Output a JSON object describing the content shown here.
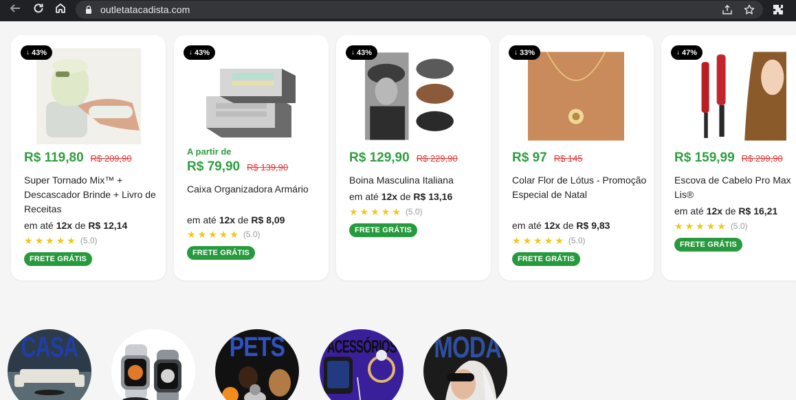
{
  "browser": {
    "url": "outletatacadista.com",
    "icons": [
      "back-arrow-icon",
      "reload-icon",
      "home-icon",
      "lock-icon",
      "share-icon",
      "star-icon",
      "extensions-icon"
    ]
  },
  "colors": {
    "price_green": "#2e9e3f",
    "old_price_red": "#e2332f",
    "badge_bg": "#000000",
    "frete_bg": "#279a3d",
    "star": "#f5c518"
  },
  "products": [
    {
      "discount": "43%",
      "from_label": "",
      "price": "R$ 119,80",
      "old_price": "R$ 209,90",
      "title": "Super Tornado Mix™ + Descascador Brinde + Livro de Receitas",
      "inst_prefix": "em até",
      "inst_times": "12x",
      "inst_de": "de",
      "inst_value": "R$ 12,14",
      "rating": "(5.0)",
      "rating_value": 5,
      "frete": "FRETE GRÁTIS"
    },
    {
      "discount": "43%",
      "from_label": "A partir de",
      "price": "R$ 79,90",
      "old_price": "R$ 139,90",
      "title": "Caixa Organizadora Armário",
      "inst_prefix": "em até",
      "inst_times": "12x",
      "inst_de": "de",
      "inst_value": "R$ 8,09",
      "rating": "(5.0)",
      "rating_value": 5,
      "frete": "FRETE GRÁTIS"
    },
    {
      "discount": "43%",
      "from_label": "",
      "price": "R$ 129,90",
      "old_price": "R$ 229,90",
      "title": "Boina Masculina Italiana",
      "inst_prefix": "em até",
      "inst_times": "12x",
      "inst_de": "de",
      "inst_value": "R$ 13,16",
      "rating": "(5.0)",
      "rating_value": 5,
      "frete": "FRETE GRÁTIS"
    },
    {
      "discount": "33%",
      "from_label": "",
      "price": "R$ 97",
      "old_price": "R$ 145",
      "title": "Colar Flor de Lótus - Promoção Especial de Natal",
      "inst_prefix": "em até",
      "inst_times": "12x",
      "inst_de": "de",
      "inst_value": "R$ 9,83",
      "rating": "(5.0)",
      "rating_value": 5,
      "frete": "FRETE GRÁTIS"
    },
    {
      "discount": "47%",
      "from_label": "",
      "price": "R$ 159,99",
      "old_price": "R$ 299,90",
      "title": "Escova de Cabelo Pro Max Lis®",
      "inst_prefix": "em até",
      "inst_times": "12x",
      "inst_de": "de",
      "inst_value": "R$ 16,21",
      "rating": "(5.0)",
      "rating_value": 5,
      "frete": "FRETE GRÁTIS"
    }
  ],
  "categories": [
    {
      "label": "CASA"
    },
    {
      "label": ""
    },
    {
      "label": "PETS"
    },
    {
      "label": "ACESSÓRIOS"
    },
    {
      "label": "MODA"
    }
  ]
}
